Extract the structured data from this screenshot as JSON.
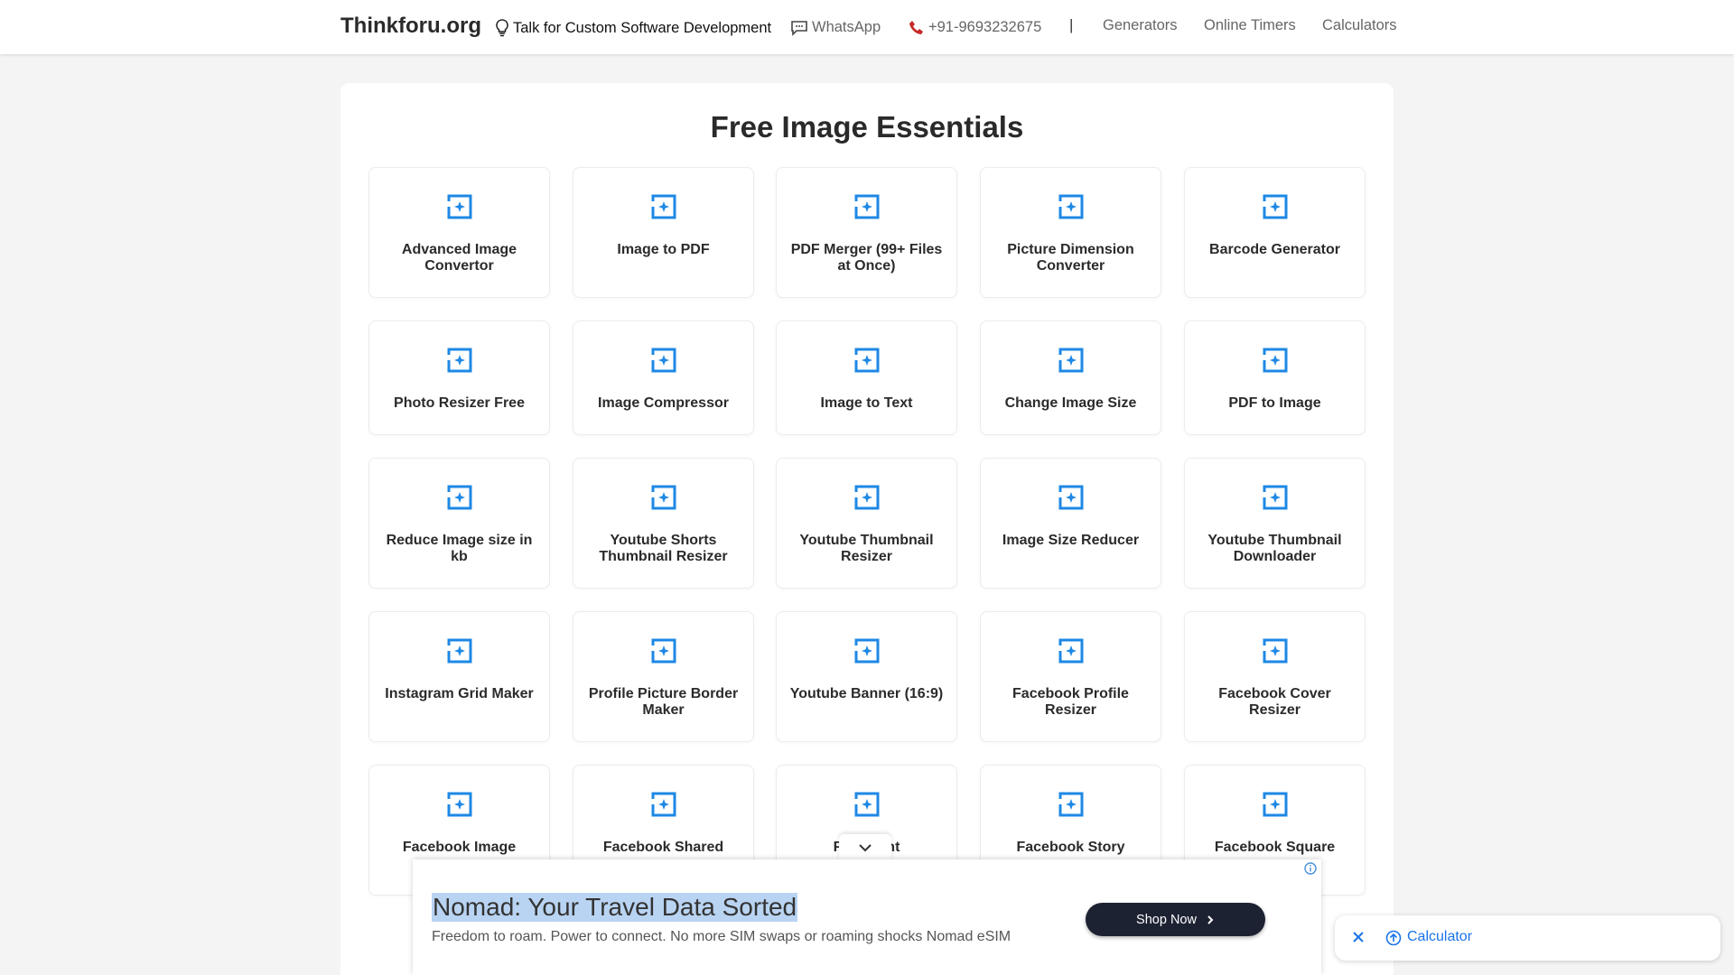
{
  "header": {
    "brand": "Thinkforu.org",
    "custom_dev": "Talk for Custom Software Development",
    "whatsapp": "WhatsApp",
    "phone": "+91-9693232675",
    "separator": "|",
    "links": [
      "Generators",
      "Online Timers",
      "Calculators"
    ]
  },
  "main": {
    "title": "Free Image Essentials",
    "tools": [
      {
        "label": "Advanced Image Convertor",
        "icon": "magic-image-icon"
      },
      {
        "label": "Image to PDF",
        "icon": "magic-image-icon"
      },
      {
        "label": "PDF Merger (99+ Files at Once)",
        "icon": "magic-image-icon"
      },
      {
        "label": "Picture Dimension Converter",
        "icon": "magic-image-icon"
      },
      {
        "label": "Barcode Generator",
        "icon": "magic-image-icon"
      },
      {
        "label": "Photo Resizer Free",
        "icon": "magic-image-icon"
      },
      {
        "label": "Image Compressor",
        "icon": "magic-image-icon"
      },
      {
        "label": "Image to Text",
        "icon": "magic-image-icon"
      },
      {
        "label": "Change Image Size",
        "icon": "magic-image-icon"
      },
      {
        "label": "PDF to Image",
        "icon": "magic-image-icon"
      },
      {
        "label": "Reduce Image size in kb",
        "icon": "magic-image-icon"
      },
      {
        "label": "Youtube Shorts Thumbnail Resizer",
        "icon": "magic-image-icon"
      },
      {
        "label": "Youtube Thumbnail Resizer",
        "icon": "magic-image-icon"
      },
      {
        "label": "Image Size Reducer",
        "icon": "magic-image-icon"
      },
      {
        "label": "Youtube Thumbnail Downloader",
        "icon": "magic-image-icon"
      },
      {
        "label": "Instagram Grid Maker",
        "icon": "magic-image-icon"
      },
      {
        "label": "Profile Picture Border Maker",
        "icon": "magic-image-icon"
      },
      {
        "label": "Youtube Banner (16:9)",
        "icon": "magic-image-icon"
      },
      {
        "label": "Facebook Profile Resizer",
        "icon": "magic-image-icon"
      },
      {
        "label": "Facebook Cover Resizer",
        "icon": "magic-image-icon"
      },
      {
        "label": "Facebook Image",
        "icon": "magic-image-icon"
      },
      {
        "label": "Facebook Shared",
        "icon": "magic-image-icon"
      },
      {
        "label": "Face      vent",
        "icon": "magic-image-icon"
      },
      {
        "label": "Facebook Story",
        "icon": "magic-image-icon"
      },
      {
        "label": "Facebook Square",
        "icon": "magic-image-icon"
      }
    ]
  },
  "ad": {
    "title": "Nomad: Your Travel Data Sorted",
    "subtitle": "Freedom to roam. Power to connect. No more SIM swaps or roaming shocks Nomad eSIM",
    "button": "Shop Now"
  },
  "calculator_widget": {
    "label": "Calculator"
  },
  "colors": {
    "accent": "#1a73e8",
    "icon_blue": "#1e88e5",
    "ad_button": "#1d2233",
    "highlight": "#b9d4f2"
  }
}
